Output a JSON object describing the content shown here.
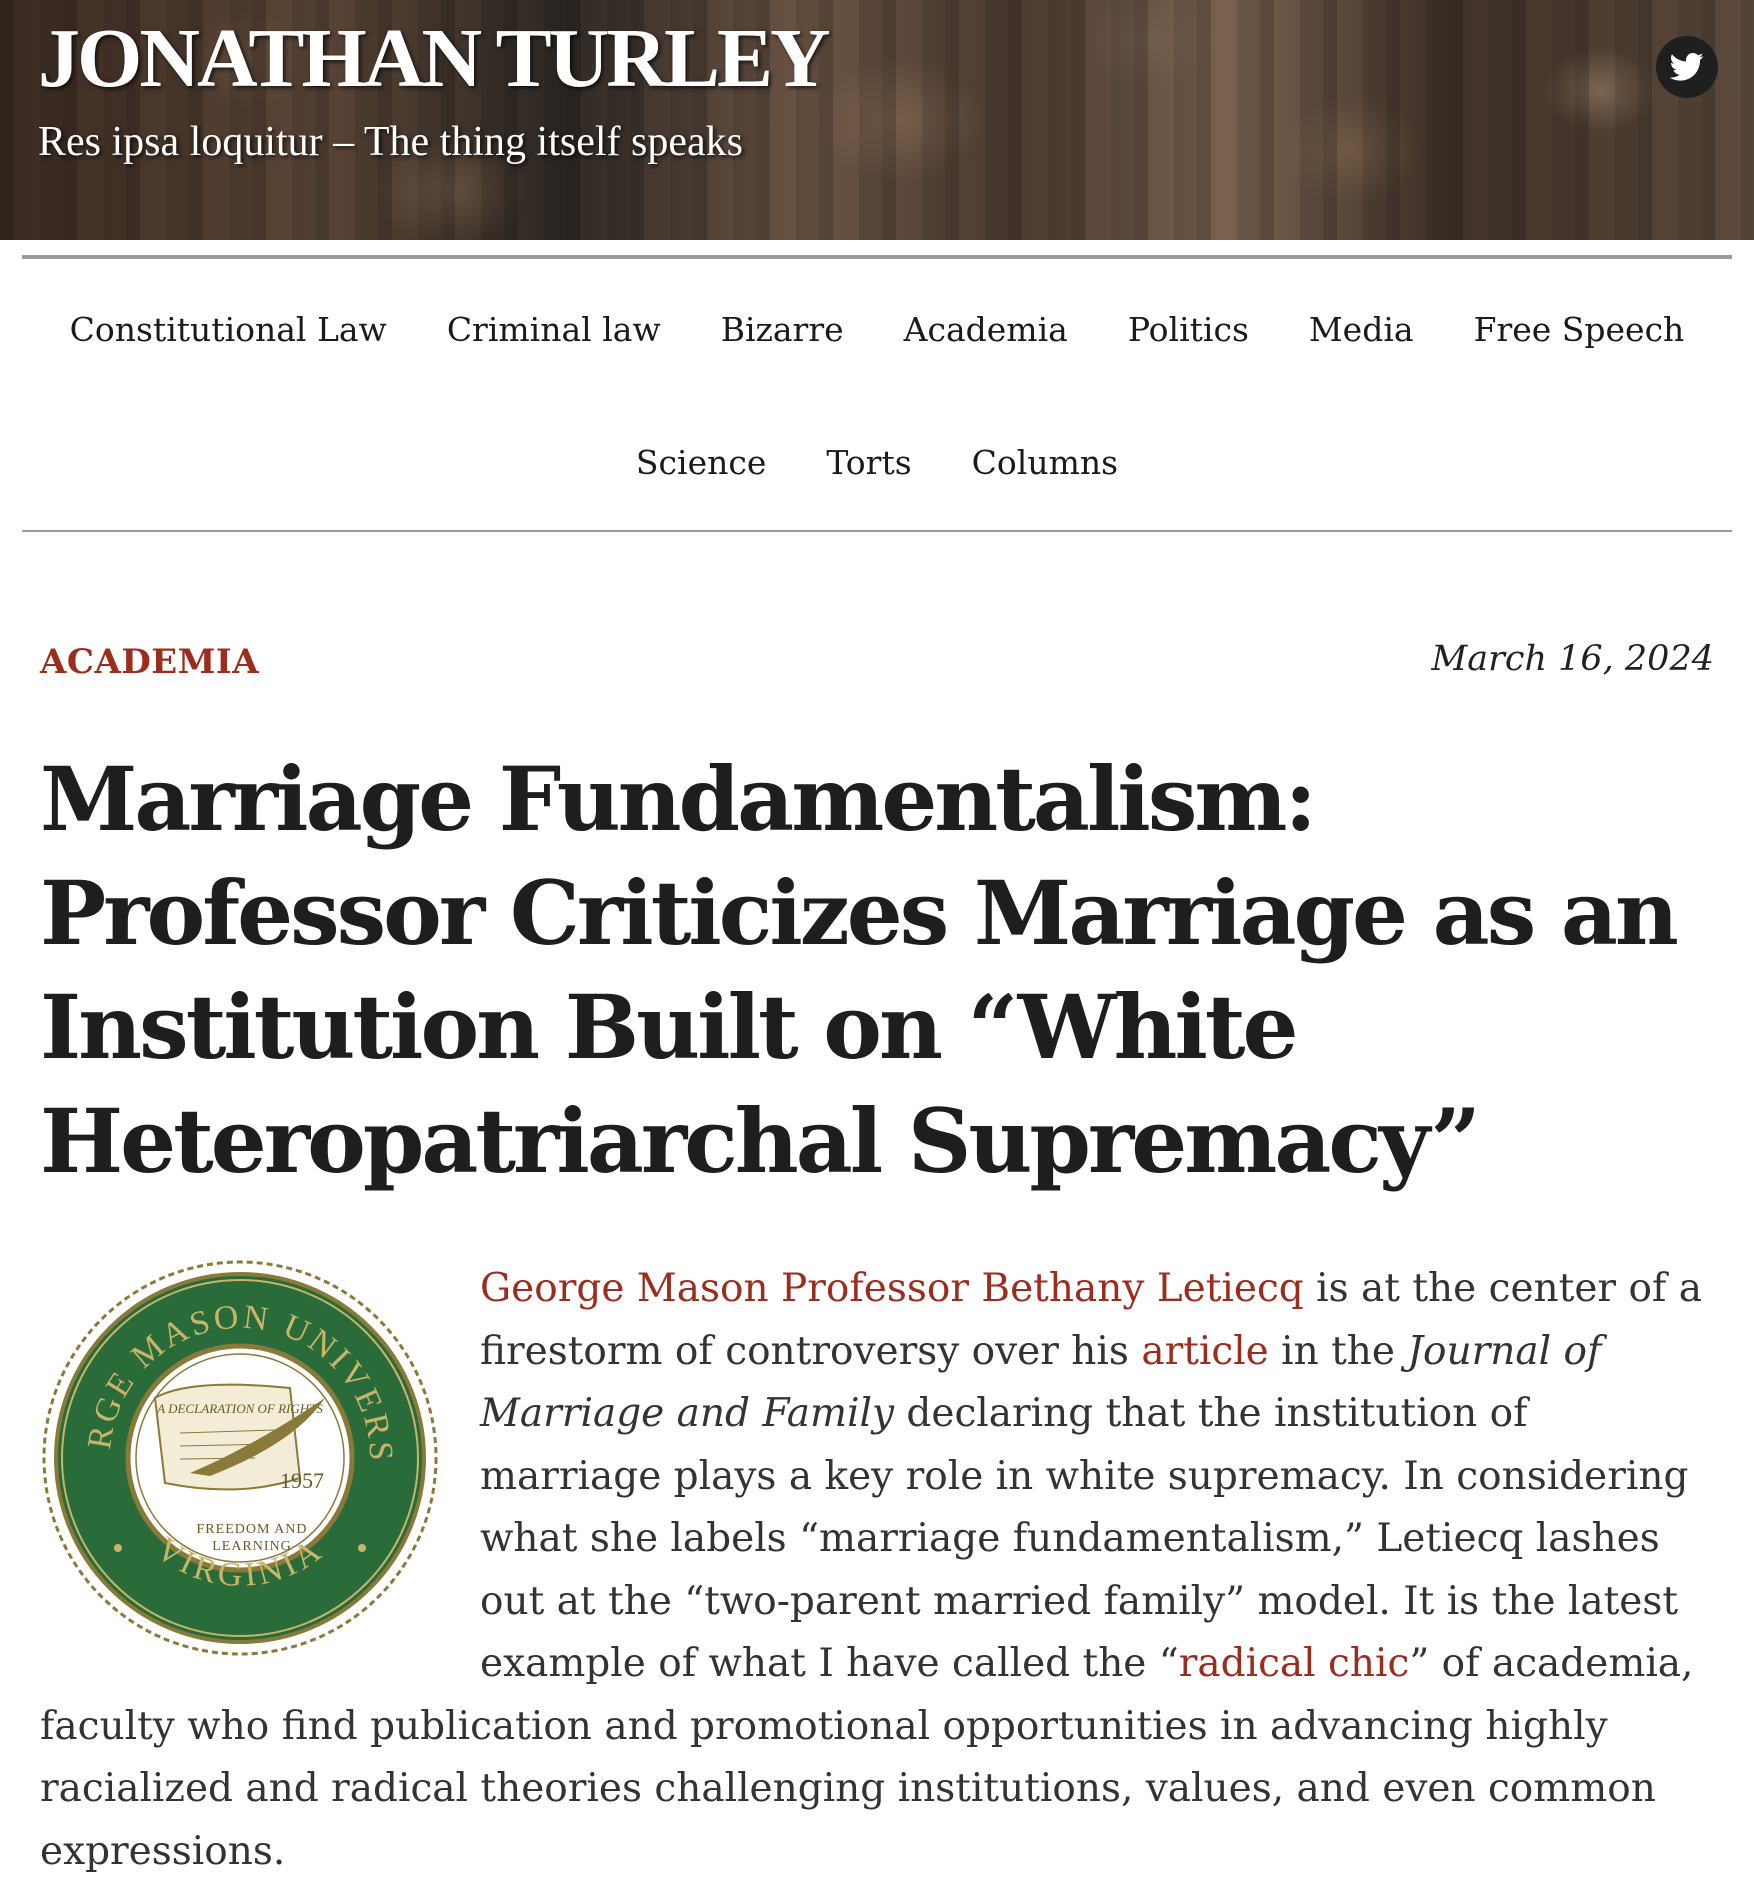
{
  "header": {
    "site_title": "JONATHAN TURLEY",
    "tagline": "Res ipsa loquitur – The thing itself speaks",
    "social_icon": "twitter-icon"
  },
  "nav": {
    "row1": [
      "Constitutional Law",
      "Criminal law",
      "Bizarre",
      "Academia",
      "Politics",
      "Media",
      "Free Speech"
    ],
    "row2": [
      "Science",
      "Torts",
      "Columns"
    ]
  },
  "post": {
    "category": "ACADEMIA",
    "date": "March 16, 2024",
    "title": "Marriage Fundamentalism: Professor Criticizes Marriage as an Institution Built on “White Heteropatriarchal Supremacy”",
    "seal": {
      "ring_top": "GEORGE MASON UNIVERSITY",
      "ring_bottom": "VIRGINIA",
      "scroll": "A DECLARATION OF RIGHTS",
      "year": "1957",
      "motto_line1": "FREEDOM AND",
      "motto_line2": "LEARNING"
    },
    "paragraph": {
      "link1": "George Mason Professor Bethany Letiecq",
      "t1": " is at the center of a firestorm of controversy over his ",
      "link2": "article",
      "t2": " in the ",
      "journal": "Journal of Marriage and Family",
      "t3": " declaring that the institution of marriage plays a key role in white supremacy. In considering what she labels “marriage fundamentalism,” Letiecq lashes out at the “two-parent married family” model.  It is the latest example of what I have called the “",
      "link3": "radical chic",
      "t4": "” of academia, faculty who find publication and promotional opportunities in advancing highly racialized and radical theories challenging institutions, values, and even common expressions."
    }
  },
  "colors": {
    "accent": "#9b2d1f",
    "seal_green": "#2a6b3a",
    "seal_gold": "#8a7a3a"
  }
}
